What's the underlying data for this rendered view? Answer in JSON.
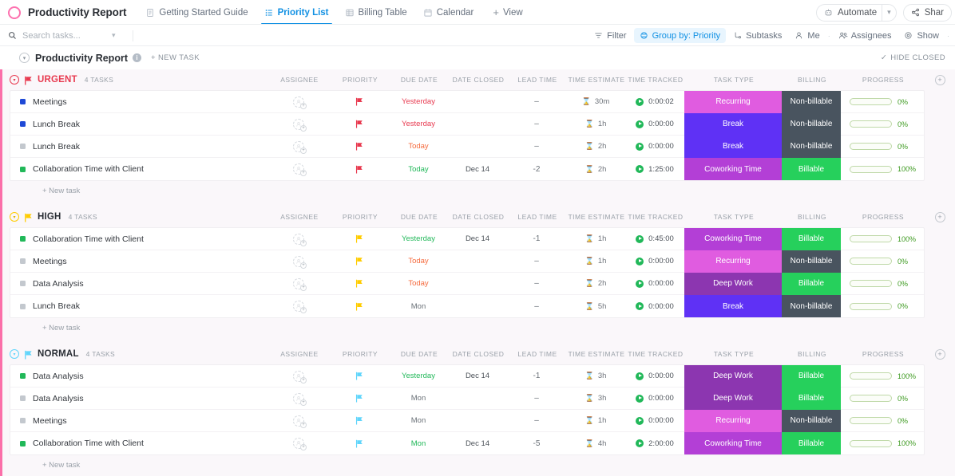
{
  "topbar": {
    "list_icon": "circle-outline-icon",
    "title": "Productivity Report",
    "tabs": [
      {
        "label": "Getting Started Guide",
        "icon": "doc-icon",
        "active": false
      },
      {
        "label": "Priority List",
        "icon": "list-icon",
        "active": true
      },
      {
        "label": "Billing Table",
        "icon": "table-icon",
        "active": false
      },
      {
        "label": "Calendar",
        "icon": "calendar-icon",
        "active": false
      }
    ],
    "add_view_label": "View",
    "automate_label": "Automate",
    "share_label": "Shar",
    "accent_blue": "#1090e3",
    "accent_pink": "#fd71af"
  },
  "filterbar": {
    "search_placeholder": "Search tasks...",
    "search_value": "",
    "buttons": [
      {
        "label": "Filter",
        "icon": "filter-icon",
        "active": false
      },
      {
        "label": "Group by: Priority",
        "icon": "group-icon",
        "active": true
      },
      {
        "label": "Subtasks",
        "icon": "subtask-icon",
        "active": false
      },
      {
        "label": "Me",
        "icon": "person-icon",
        "active": false
      },
      {
        "label": "Assignees",
        "icon": "people-icon",
        "active": false
      },
      {
        "label": "Show",
        "icon": "eye-icon",
        "active": false
      }
    ]
  },
  "pagehead": {
    "title": "Productivity Report",
    "info_glyph": "i",
    "new_task_label": "+ NEW TASK",
    "hide_closed_label": "HIDE CLOSED",
    "hide_closed_check": "✓"
  },
  "columns": [
    {
      "key": "assignee",
      "label": "ASSIGNEE",
      "width": 78
    },
    {
      "key": "priority",
      "label": "PRIORITY",
      "width": 74
    },
    {
      "key": "due_date",
      "label": "DUE DATE",
      "width": 74
    },
    {
      "key": "date_closed",
      "label": "DATE CLOSED",
      "width": 74
    },
    {
      "key": "lead_time",
      "label": "LEAD TIME",
      "width": 74
    },
    {
      "key": "time_estimate",
      "label": "TIME ESTIMATE",
      "width": 74
    },
    {
      "key": "time_tracked",
      "label": "TIME TRACKED",
      "width": 74
    },
    {
      "key": "task_type",
      "label": "TASK TYPE",
      "width": 122
    },
    {
      "key": "billing",
      "label": "BILLING",
      "width": 74
    },
    {
      "key": "progress",
      "label": "PROGRESS",
      "width": 104
    }
  ],
  "new_task_label": "+ New task",
  "tag_colors": {
    "Recurring": "#e05ce0",
    "Break": "#5f31f5",
    "Coworking Time": "#b33fd6",
    "Deep Work": "#8c36b0",
    "Billable": "#26d05c",
    "Non-billable": "#49545f"
  },
  "groups": [
    {
      "name": "URGENT",
      "count_label": "4 TASKS",
      "color": "#e8394f",
      "flag": "urgent-flag-icon",
      "tasks": [
        {
          "status_color": "#1e49d6",
          "name": "Meetings",
          "priority_color": "#e8394f",
          "due_date": "Yesterday",
          "due_color": "#e8394f",
          "date_closed": "",
          "lead_time": "–",
          "time_estimate": "30m",
          "time_tracked": "0:00:02",
          "task_type": "Recurring",
          "billing": "Non-billable",
          "progress": 0
        },
        {
          "status_color": "#1e49d6",
          "name": "Lunch Break",
          "priority_color": "#e8394f",
          "due_date": "Yesterday",
          "due_color": "#e8394f",
          "date_closed": "",
          "lead_time": "–",
          "time_estimate": "1h",
          "time_tracked": "0:00:00",
          "task_type": "Break",
          "billing": "Non-billable",
          "progress": 0
        },
        {
          "status_color": "#c3c8ce",
          "name": "Lunch Break",
          "priority_color": "#e8394f",
          "due_date": "Today",
          "due_color": "#f56b3e",
          "date_closed": "",
          "lead_time": "–",
          "time_estimate": "2h",
          "time_tracked": "0:00:00",
          "task_type": "Break",
          "billing": "Non-billable",
          "progress": 0
        },
        {
          "status_color": "#21b859",
          "name": "Collaboration Time with Client",
          "priority_color": "#e8394f",
          "due_date": "Today",
          "due_color": "#21b859",
          "date_closed": "Dec 14",
          "lead_time": "-2",
          "time_estimate": "2h",
          "time_tracked": "1:25:00",
          "task_type": "Coworking Time",
          "billing": "Billable",
          "progress": 100
        }
      ]
    },
    {
      "name": "HIGH",
      "count_label": "4 TASKS",
      "color": "#292d34",
      "flag": "high-flag-icon",
      "flag_color": "#ffcc00",
      "tasks": [
        {
          "status_color": "#21b859",
          "name": "Collaboration Time with Client",
          "priority_color": "#ffcc00",
          "due_date": "Yesterday",
          "due_color": "#21b859",
          "date_closed": "Dec 14",
          "lead_time": "-1",
          "time_estimate": "1h",
          "time_tracked": "0:45:00",
          "task_type": "Coworking Time",
          "billing": "Billable",
          "progress": 100
        },
        {
          "status_color": "#c3c8ce",
          "name": "Meetings",
          "priority_color": "#ffcc00",
          "due_date": "Today",
          "due_color": "#f56b3e",
          "date_closed": "",
          "lead_time": "–",
          "time_estimate": "1h",
          "time_tracked": "0:00:00",
          "task_type": "Recurring",
          "billing": "Non-billable",
          "progress": 0
        },
        {
          "status_color": "#c3c8ce",
          "name": "Data Analysis",
          "priority_color": "#ffcc00",
          "due_date": "Today",
          "due_color": "#f56b3e",
          "date_closed": "",
          "lead_time": "–",
          "time_estimate": "2h",
          "time_tracked": "0:00:00",
          "task_type": "Deep Work",
          "billing": "Billable",
          "progress": 0
        },
        {
          "status_color": "#c3c8ce",
          "name": "Lunch Break",
          "priority_color": "#ffcc00",
          "due_date": "Mon",
          "due_color": "#6a7178",
          "date_closed": "",
          "lead_time": "–",
          "time_estimate": "5h",
          "time_tracked": "0:00:00",
          "task_type": "Break",
          "billing": "Non-billable",
          "progress": 0
        }
      ]
    },
    {
      "name": "NORMAL",
      "count_label": "4 TASKS",
      "color": "#292d34",
      "flag": "normal-flag-icon",
      "flag_color": "#61d5fb",
      "tasks": [
        {
          "status_color": "#21b859",
          "name": "Data Analysis",
          "priority_color": "#61d5fb",
          "due_date": "Yesterday",
          "due_color": "#21b859",
          "date_closed": "Dec 14",
          "lead_time": "-1",
          "time_estimate": "3h",
          "time_tracked": "0:00:00",
          "task_type": "Deep Work",
          "billing": "Billable",
          "progress": 100
        },
        {
          "status_color": "#c3c8ce",
          "name": "Data Analysis",
          "priority_color": "#61d5fb",
          "due_date": "Mon",
          "due_color": "#6a7178",
          "date_closed": "",
          "lead_time": "–",
          "time_estimate": "3h",
          "time_tracked": "0:00:00",
          "task_type": "Deep Work",
          "billing": "Billable",
          "progress": 0
        },
        {
          "status_color": "#c3c8ce",
          "name": "Meetings",
          "priority_color": "#61d5fb",
          "due_date": "Mon",
          "due_color": "#6a7178",
          "date_closed": "",
          "lead_time": "–",
          "time_estimate": "1h",
          "time_tracked": "0:00:00",
          "task_type": "Recurring",
          "billing": "Non-billable",
          "progress": 0
        },
        {
          "status_color": "#21b859",
          "name": "Collaboration Time with Client",
          "priority_color": "#61d5fb",
          "due_date": "Mon",
          "due_color": "#21b859",
          "date_closed": "Dec 14",
          "lead_time": "-5",
          "time_estimate": "4h",
          "time_tracked": "2:00:00",
          "task_type": "Coworking Time",
          "billing": "Billable",
          "progress": 100
        }
      ]
    }
  ]
}
